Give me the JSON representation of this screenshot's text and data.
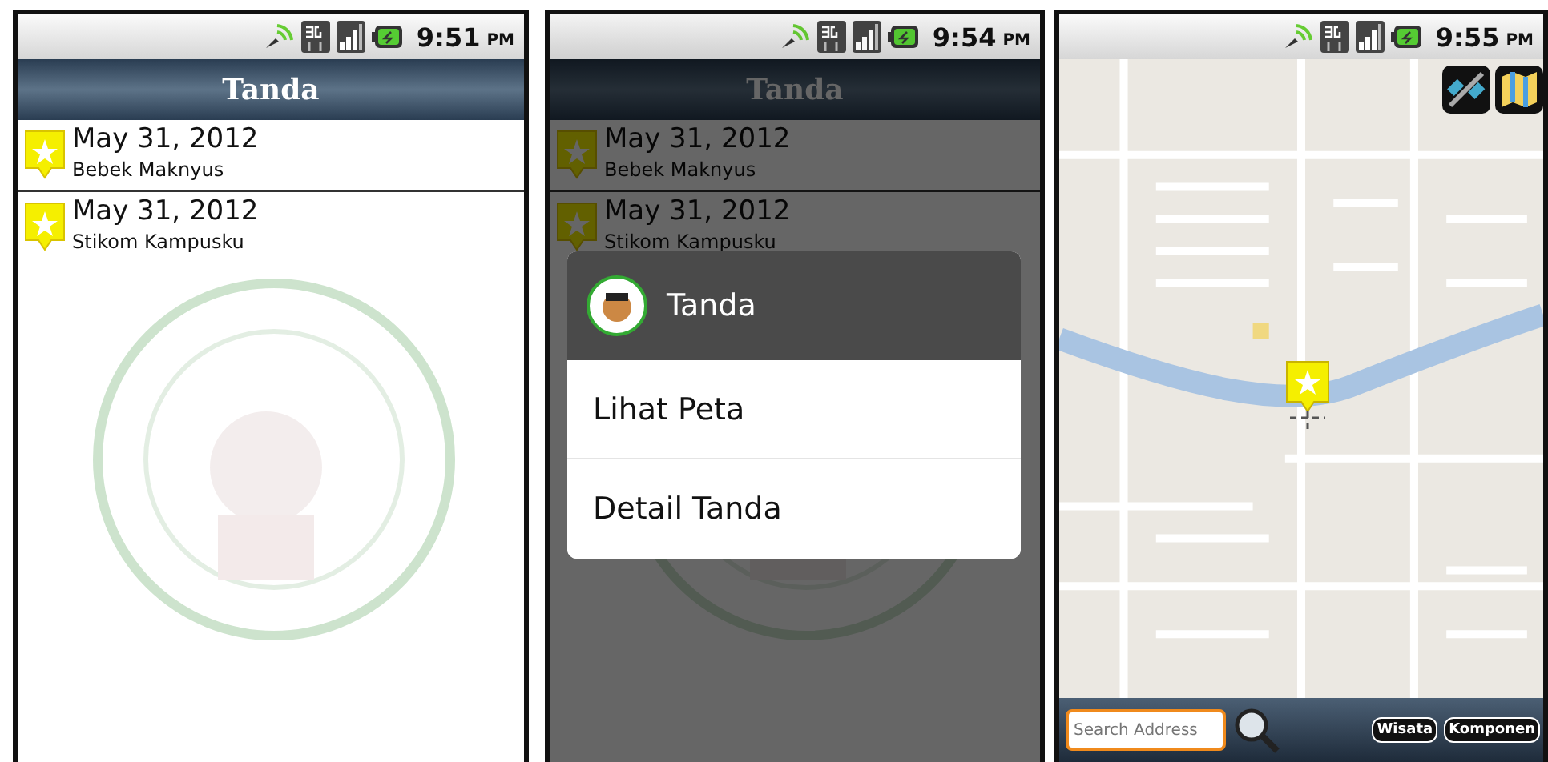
{
  "screens": [
    {
      "kind": "list",
      "status_bar": {
        "time": "9:51",
        "ampm": "PM"
      },
      "title": "Tanda",
      "items": [
        {
          "date": "May 31, 2012",
          "name": "Bebek Maknyus"
        },
        {
          "date": "May 31, 2012",
          "name": "Stikom Kampusku"
        }
      ]
    },
    {
      "kind": "dialog",
      "status_bar": {
        "time": "9:54",
        "ampm": "PM"
      },
      "title": "Tanda",
      "items": [
        {
          "date": "May 31, 2012",
          "name": "Bebek Maknyus"
        },
        {
          "date": "May 31, 2012",
          "name": "Stikom Kampusku"
        }
      ],
      "dialog": {
        "title": "Tanda",
        "options": [
          "Lihat Peta",
          "Detail Tanda"
        ]
      }
    },
    {
      "kind": "map",
      "status_bar": {
        "time": "9:55",
        "ampm": "PM"
      },
      "search": {
        "placeholder": "Search Address"
      },
      "buttons": [
        "Wisata",
        "Komponen"
      ]
    }
  ]
}
